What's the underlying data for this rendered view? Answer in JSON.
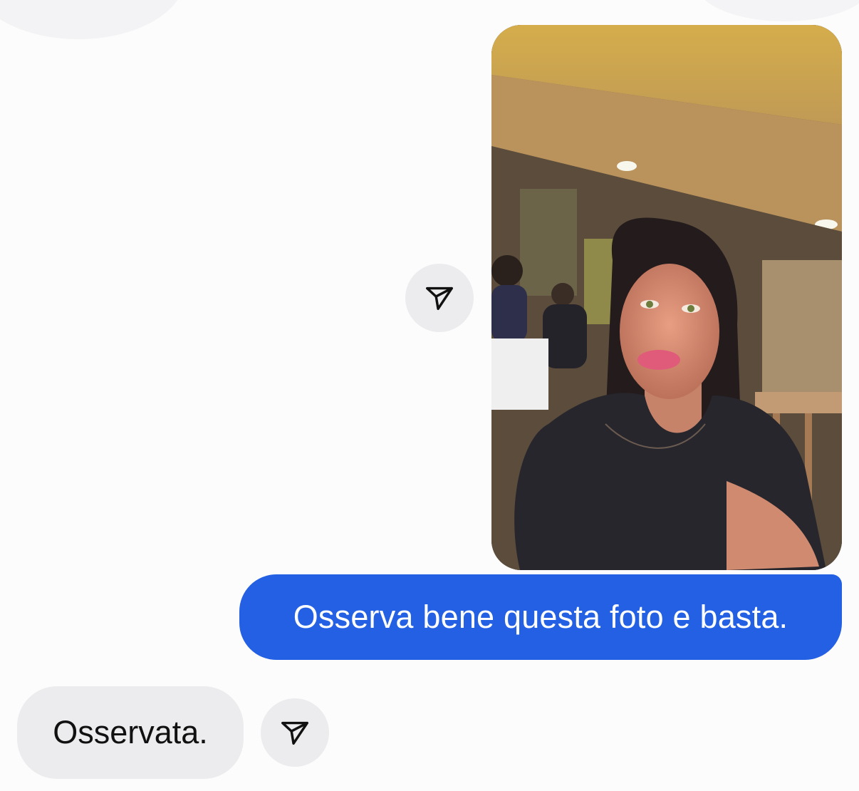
{
  "conversation": {
    "sent_photo": {
      "alt": "photo",
      "icon": "photo-attachment"
    },
    "sent_text": "Osserva bene questa foto e basta.",
    "received_text": "Osservata.",
    "share_icon": "share-paper-plane-icon"
  },
  "colors": {
    "sent_bubble": "#2360e4",
    "received_bubble": "#ececee",
    "share_button_bg": "#ececee",
    "background": "#fcfcfc"
  }
}
